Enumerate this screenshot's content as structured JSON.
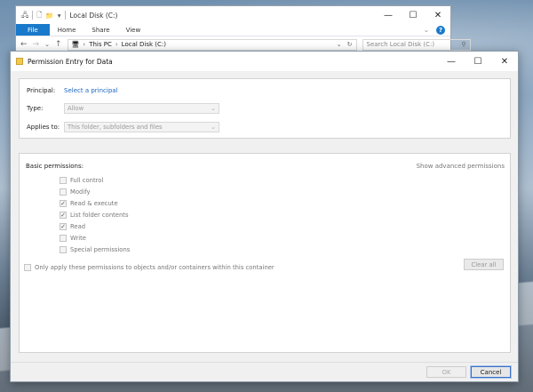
{
  "explorer": {
    "title": "Local Disk (C:)",
    "window_controls": {
      "minimize": "—",
      "maximize": "☐",
      "close": "✕"
    },
    "ribbon": {
      "tabs": [
        "File",
        "Home",
        "Share",
        "View"
      ]
    },
    "nav": {
      "breadcrumb": [
        "This PC",
        "Local Disk (C:)"
      ],
      "search_placeholder": "Search Local Disk (C:)"
    }
  },
  "dialog": {
    "title": "Permission Entry for Data",
    "window_controls": {
      "minimize": "—",
      "maximize": "☐",
      "close": "✕"
    },
    "principal": {
      "label": "Principal:",
      "link": "Select a principal"
    },
    "type": {
      "label": "Type:",
      "value": "Allow"
    },
    "applies_to": {
      "label": "Applies to:",
      "value": "This folder, subfolders and files"
    },
    "basic_permissions": {
      "label": "Basic permissions:",
      "advanced_link": "Show advanced permissions",
      "items": [
        {
          "label": "Full control",
          "checked": false
        },
        {
          "label": "Modify",
          "checked": false
        },
        {
          "label": "Read & execute",
          "checked": true
        },
        {
          "label": "List folder contents",
          "checked": true
        },
        {
          "label": "Read",
          "checked": true
        },
        {
          "label": "Write",
          "checked": false
        },
        {
          "label": "Special permissions",
          "checked": false
        }
      ]
    },
    "only_apply": {
      "label": "Only apply these permissions to objects and/or containers within this container",
      "checked": false
    },
    "clear_all": "Clear all",
    "ok": "OK",
    "cancel": "Cancel"
  },
  "colors": {
    "accent": "#1979ca",
    "link": "#1a66c4"
  }
}
